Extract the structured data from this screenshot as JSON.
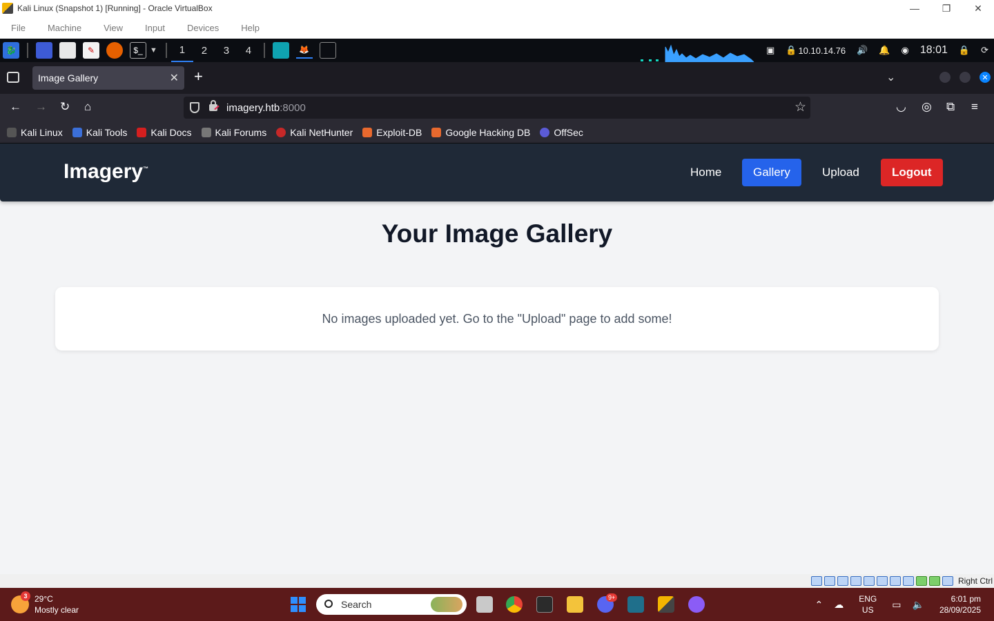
{
  "vbox": {
    "title": "Kali Linux (Snapshot 1) [Running] - Oracle VirtualBox",
    "menu": [
      "File",
      "Machine",
      "View",
      "Input",
      "Devices",
      "Help"
    ],
    "host_key": "Right Ctrl"
  },
  "kali_panel": {
    "workspaces": [
      "1",
      "2",
      "3",
      "4"
    ],
    "ip": "10.10.14.76",
    "time": "18:01"
  },
  "browser": {
    "tab_title": "Image Gallery",
    "url_host": "imagery.htb",
    "url_port": ":8000",
    "bookmarks": [
      "Kali Linux",
      "Kali Tools",
      "Kali Docs",
      "Kali Forums",
      "Kali NetHunter",
      "Exploit-DB",
      "Google Hacking DB",
      "OffSec"
    ]
  },
  "site": {
    "brand": "Imagery",
    "brand_tm": "™",
    "nav": {
      "home": "Home",
      "gallery": "Gallery",
      "upload": "Upload",
      "logout": "Logout"
    },
    "page_title": "Your Image Gallery",
    "empty_message": "No images uploaded yet. Go to the \"Upload\" page to add some!"
  },
  "taskbar": {
    "weather_badge": "3",
    "temperature": "29°C",
    "condition": "Mostly clear",
    "search_placeholder": "Search",
    "discord_badge": "9+",
    "lang_line1": "ENG",
    "lang_line2": "US",
    "clock_time": "6:01 pm",
    "clock_date": "28/09/2025"
  },
  "colors": {
    "site_header": "#1f2937",
    "gallery_active": "#2563eb",
    "logout": "#dc2626",
    "taskbar": "#5c1a1a"
  }
}
